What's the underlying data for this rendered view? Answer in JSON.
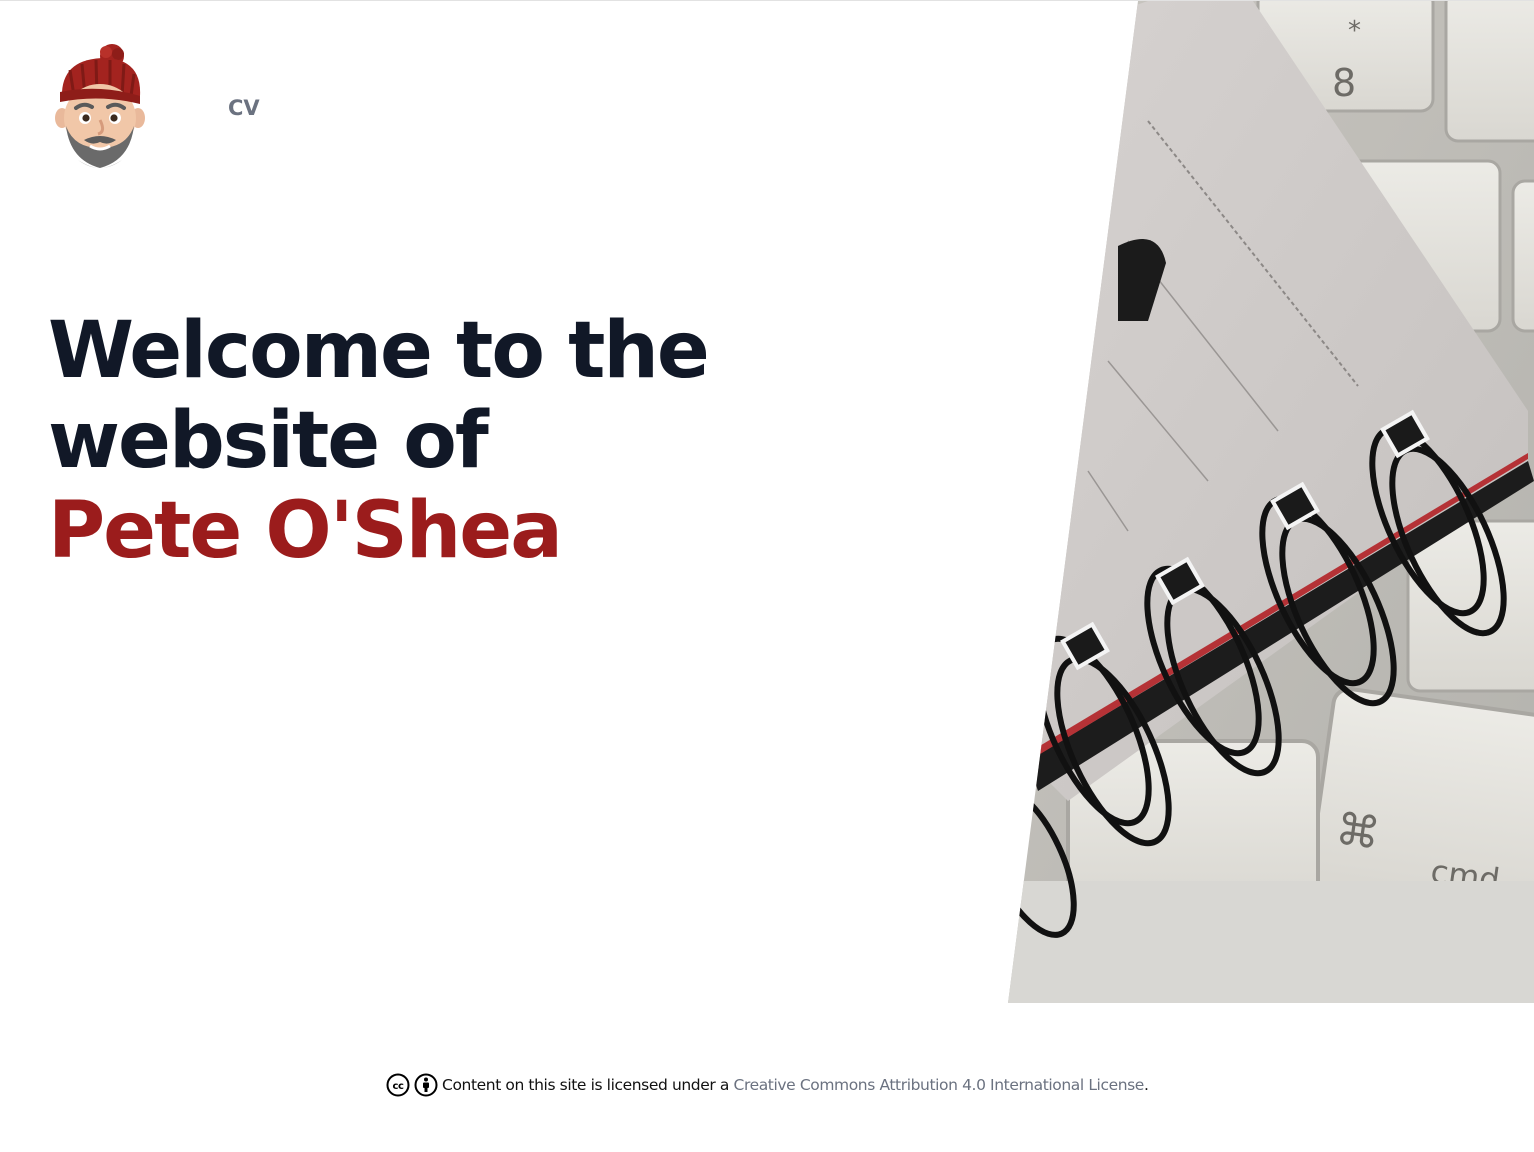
{
  "nav": {
    "avatar_icon": "memoji-avatar-icon",
    "cv_label": "CV"
  },
  "hero": {
    "line1": "Welcome to the",
    "line2": "website of",
    "name": "Pete O'Shea"
  },
  "footer": {
    "icons": [
      "cc-icon",
      "by-attribution-icon"
    ],
    "prefix": "Content on this site is licensed under a",
    "link_label": "Creative Commons Attribution 4.0 International License",
    "suffix": "."
  },
  "colors": {
    "heading": "#111827",
    "name_accent": "#9b1c1c",
    "nav_text": "#6b7280",
    "link": "#6b7280"
  }
}
